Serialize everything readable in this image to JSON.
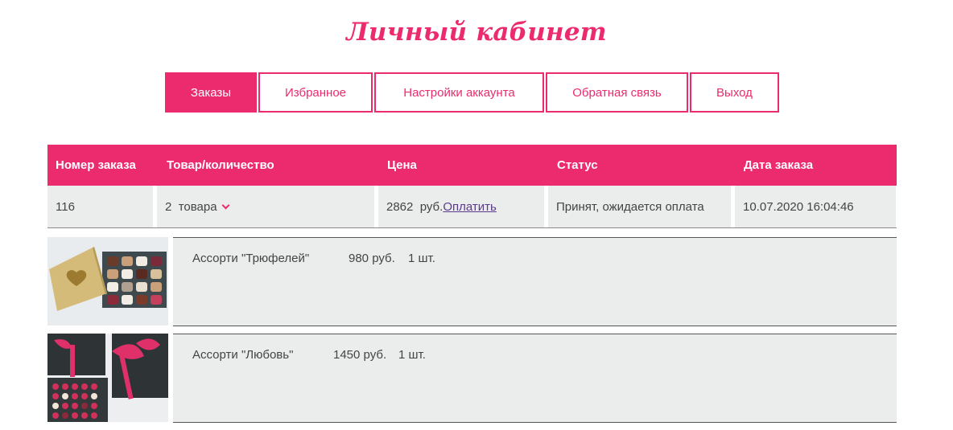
{
  "page": {
    "title": "Личный кабинет"
  },
  "tabs": [
    {
      "label": "Заказы",
      "active": true
    },
    {
      "label": "Избранное",
      "active": false
    },
    {
      "label": "Настройки аккаунта",
      "active": false
    },
    {
      "label": "Обратная связь",
      "active": false
    },
    {
      "label": "Выход",
      "active": false
    }
  ],
  "orders_table": {
    "headers": [
      "Номер заказа",
      "Товар/количество",
      "Цена",
      "Статус",
      "Дата заказа"
    ],
    "rows": [
      {
        "order_number": "116",
        "goods_count": "2",
        "goods_word": "товара",
        "price": "2862",
        "currency": "руб.",
        "pay_link": "Оплатить",
        "status": "Принят, ожидается оплата",
        "date": "10.07.2020 16:04:46"
      }
    ]
  },
  "order_items": [
    {
      "name": "Ассорти \"Трюфелей\"",
      "price": "980 руб.",
      "qty": "1 шт.",
      "image": "truffle-box-image"
    },
    {
      "name": "Ассорти \"Любовь\"",
      "price": "1450 руб.",
      "qty": "1 шт.",
      "image": "heart-chocolates-box-image"
    }
  ],
  "colors": {
    "accent": "#ec2a6e",
    "cell_bg": "#ebeded",
    "text": "#444444",
    "link": "#5a3a8a"
  }
}
